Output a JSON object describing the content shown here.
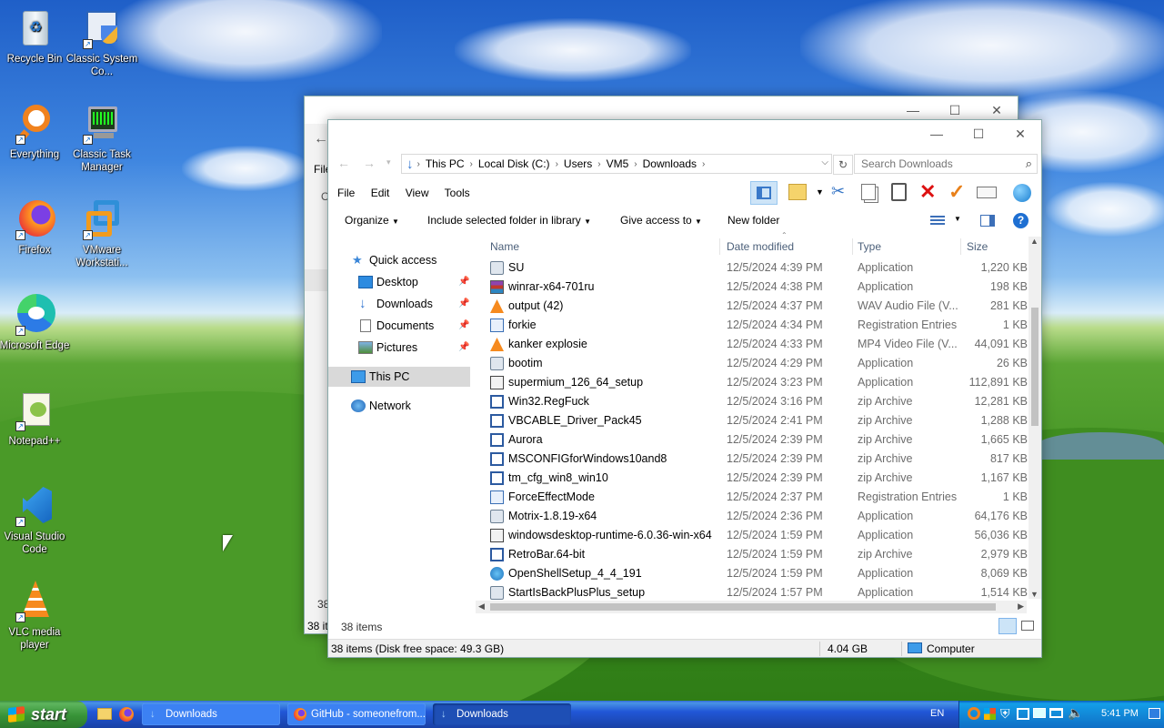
{
  "desktop_icons": [
    {
      "label": "Recycle Bin",
      "icon": "recycle-bin-icon"
    },
    {
      "label": "Classic System Co...",
      "icon": "control-panel-icon"
    },
    {
      "label": "Everything",
      "icon": "search-icon"
    },
    {
      "label": "Classic Task Manager",
      "icon": "task-manager-icon"
    },
    {
      "label": "Firefox",
      "icon": "firefox-icon"
    },
    {
      "label": "VMware Workstati...",
      "icon": "vmware-icon"
    },
    {
      "label": "Microsoft Edge",
      "icon": "edge-icon"
    },
    {
      "label": "Notepad++",
      "icon": "notepadpp-icon"
    },
    {
      "label": "Visual Studio Code",
      "icon": "vscode-icon"
    },
    {
      "label": "VLC media player",
      "icon": "vlc-icon"
    }
  ],
  "back_window": {
    "menu_file": "File",
    "letter_o": "O",
    "count_partial": "38",
    "status_partial": "38 it"
  },
  "explorer": {
    "breadcrumb": [
      "This PC",
      "Local Disk (C:)",
      "Users",
      "VM5",
      "Downloads"
    ],
    "search_placeholder": "Search Downloads",
    "menu": [
      "File",
      "Edit",
      "View",
      "Tools"
    ],
    "command_bar": {
      "organize": "Organize",
      "include": "Include selected folder in library",
      "give_access": "Give access to",
      "new_folder": "New folder"
    },
    "nav": {
      "quick_access": "Quick access",
      "desktop": "Desktop",
      "downloads": "Downloads",
      "documents": "Documents",
      "pictures": "Pictures",
      "this_pc": "This PC",
      "network": "Network"
    },
    "columns": {
      "name": "Name",
      "date": "Date modified",
      "type": "Type",
      "size": "Size"
    },
    "files": [
      {
        "name": "SU",
        "date": "12/5/2024 4:39 PM",
        "type": "Application",
        "size": "1,220 KB",
        "icon": "app-icon"
      },
      {
        "name": "winrar-x64-701ru",
        "date": "12/5/2024 4:38 PM",
        "type": "Application",
        "size": "198 KB",
        "icon": "winrar-icon"
      },
      {
        "name": "output (42)",
        "date": "12/5/2024 4:37 PM",
        "type": "WAV Audio File (V...",
        "size": "281 KB",
        "icon": "vlc-icon"
      },
      {
        "name": "forkie",
        "date": "12/5/2024 4:34 PM",
        "type": "Registration Entries",
        "size": "1 KB",
        "icon": "reg-icon"
      },
      {
        "name": "kanker explosie",
        "date": "12/5/2024 4:33 PM",
        "type": "MP4 Video File (V...",
        "size": "44,091 KB",
        "icon": "vlc-icon"
      },
      {
        "name": "bootim",
        "date": "12/5/2024 4:29 PM",
        "type": "Application",
        "size": "26 KB",
        "icon": "app-icon"
      },
      {
        "name": "supermium_126_64_setup",
        "date": "12/5/2024 3:23 PM",
        "type": "Application",
        "size": "112,891 KB",
        "icon": "setup-icon"
      },
      {
        "name": "Win32.RegFuck",
        "date": "12/5/2024 3:16 PM",
        "type": "zip Archive",
        "size": "12,281 KB",
        "icon": "zip-icon"
      },
      {
        "name": "VBCABLE_Driver_Pack45",
        "date": "12/5/2024 2:41 PM",
        "type": "zip Archive",
        "size": "1,288 KB",
        "icon": "zip-icon"
      },
      {
        "name": "Aurora",
        "date": "12/5/2024 2:39 PM",
        "type": "zip Archive",
        "size": "1,665 KB",
        "icon": "zip-icon"
      },
      {
        "name": "MSCONFIGforWindows10and8",
        "date": "12/5/2024 2:39 PM",
        "type": "zip Archive",
        "size": "817 KB",
        "icon": "zip-icon"
      },
      {
        "name": "tm_cfg_win8_win10",
        "date": "12/5/2024 2:39 PM",
        "type": "zip Archive",
        "size": "1,167 KB",
        "icon": "zip-icon"
      },
      {
        "name": "ForceEffectMode",
        "date": "12/5/2024 2:37 PM",
        "type": "Registration Entries",
        "size": "1 KB",
        "icon": "reg-icon"
      },
      {
        "name": "Motrix-1.8.19-x64",
        "date": "12/5/2024 2:36 PM",
        "type": "Application",
        "size": "64,176 KB",
        "icon": "app-icon"
      },
      {
        "name": "windowsdesktop-runtime-6.0.36-win-x64",
        "date": "12/5/2024 1:59 PM",
        "type": "Application",
        "size": "56,036 KB",
        "icon": "setup-icon"
      },
      {
        "name": "RetroBar.64-bit",
        "date": "12/5/2024 1:59 PM",
        "type": "zip Archive",
        "size": "2,979 KB",
        "icon": "zip-icon"
      },
      {
        "name": "OpenShellSetup_4_4_191",
        "date": "12/5/2024 1:59 PM",
        "type": "Application",
        "size": "8,069 KB",
        "icon": "shell-icon"
      },
      {
        "name": "StartIsBackPlusPlus_setup",
        "date": "12/5/2024 1:57 PM",
        "type": "Application",
        "size": "1,514 KB",
        "icon": "app-icon"
      }
    ],
    "items_count": "38 items",
    "status": {
      "left": "38 items (Disk free space: 49.3 GB)",
      "size": "4.04 GB",
      "location": "Computer"
    }
  },
  "taskbar": {
    "start": "start",
    "buttons": [
      "Downloads",
      "GitHub - someonefrom...",
      "Downloads"
    ],
    "language": "EN",
    "clock": "5:41 PM"
  }
}
